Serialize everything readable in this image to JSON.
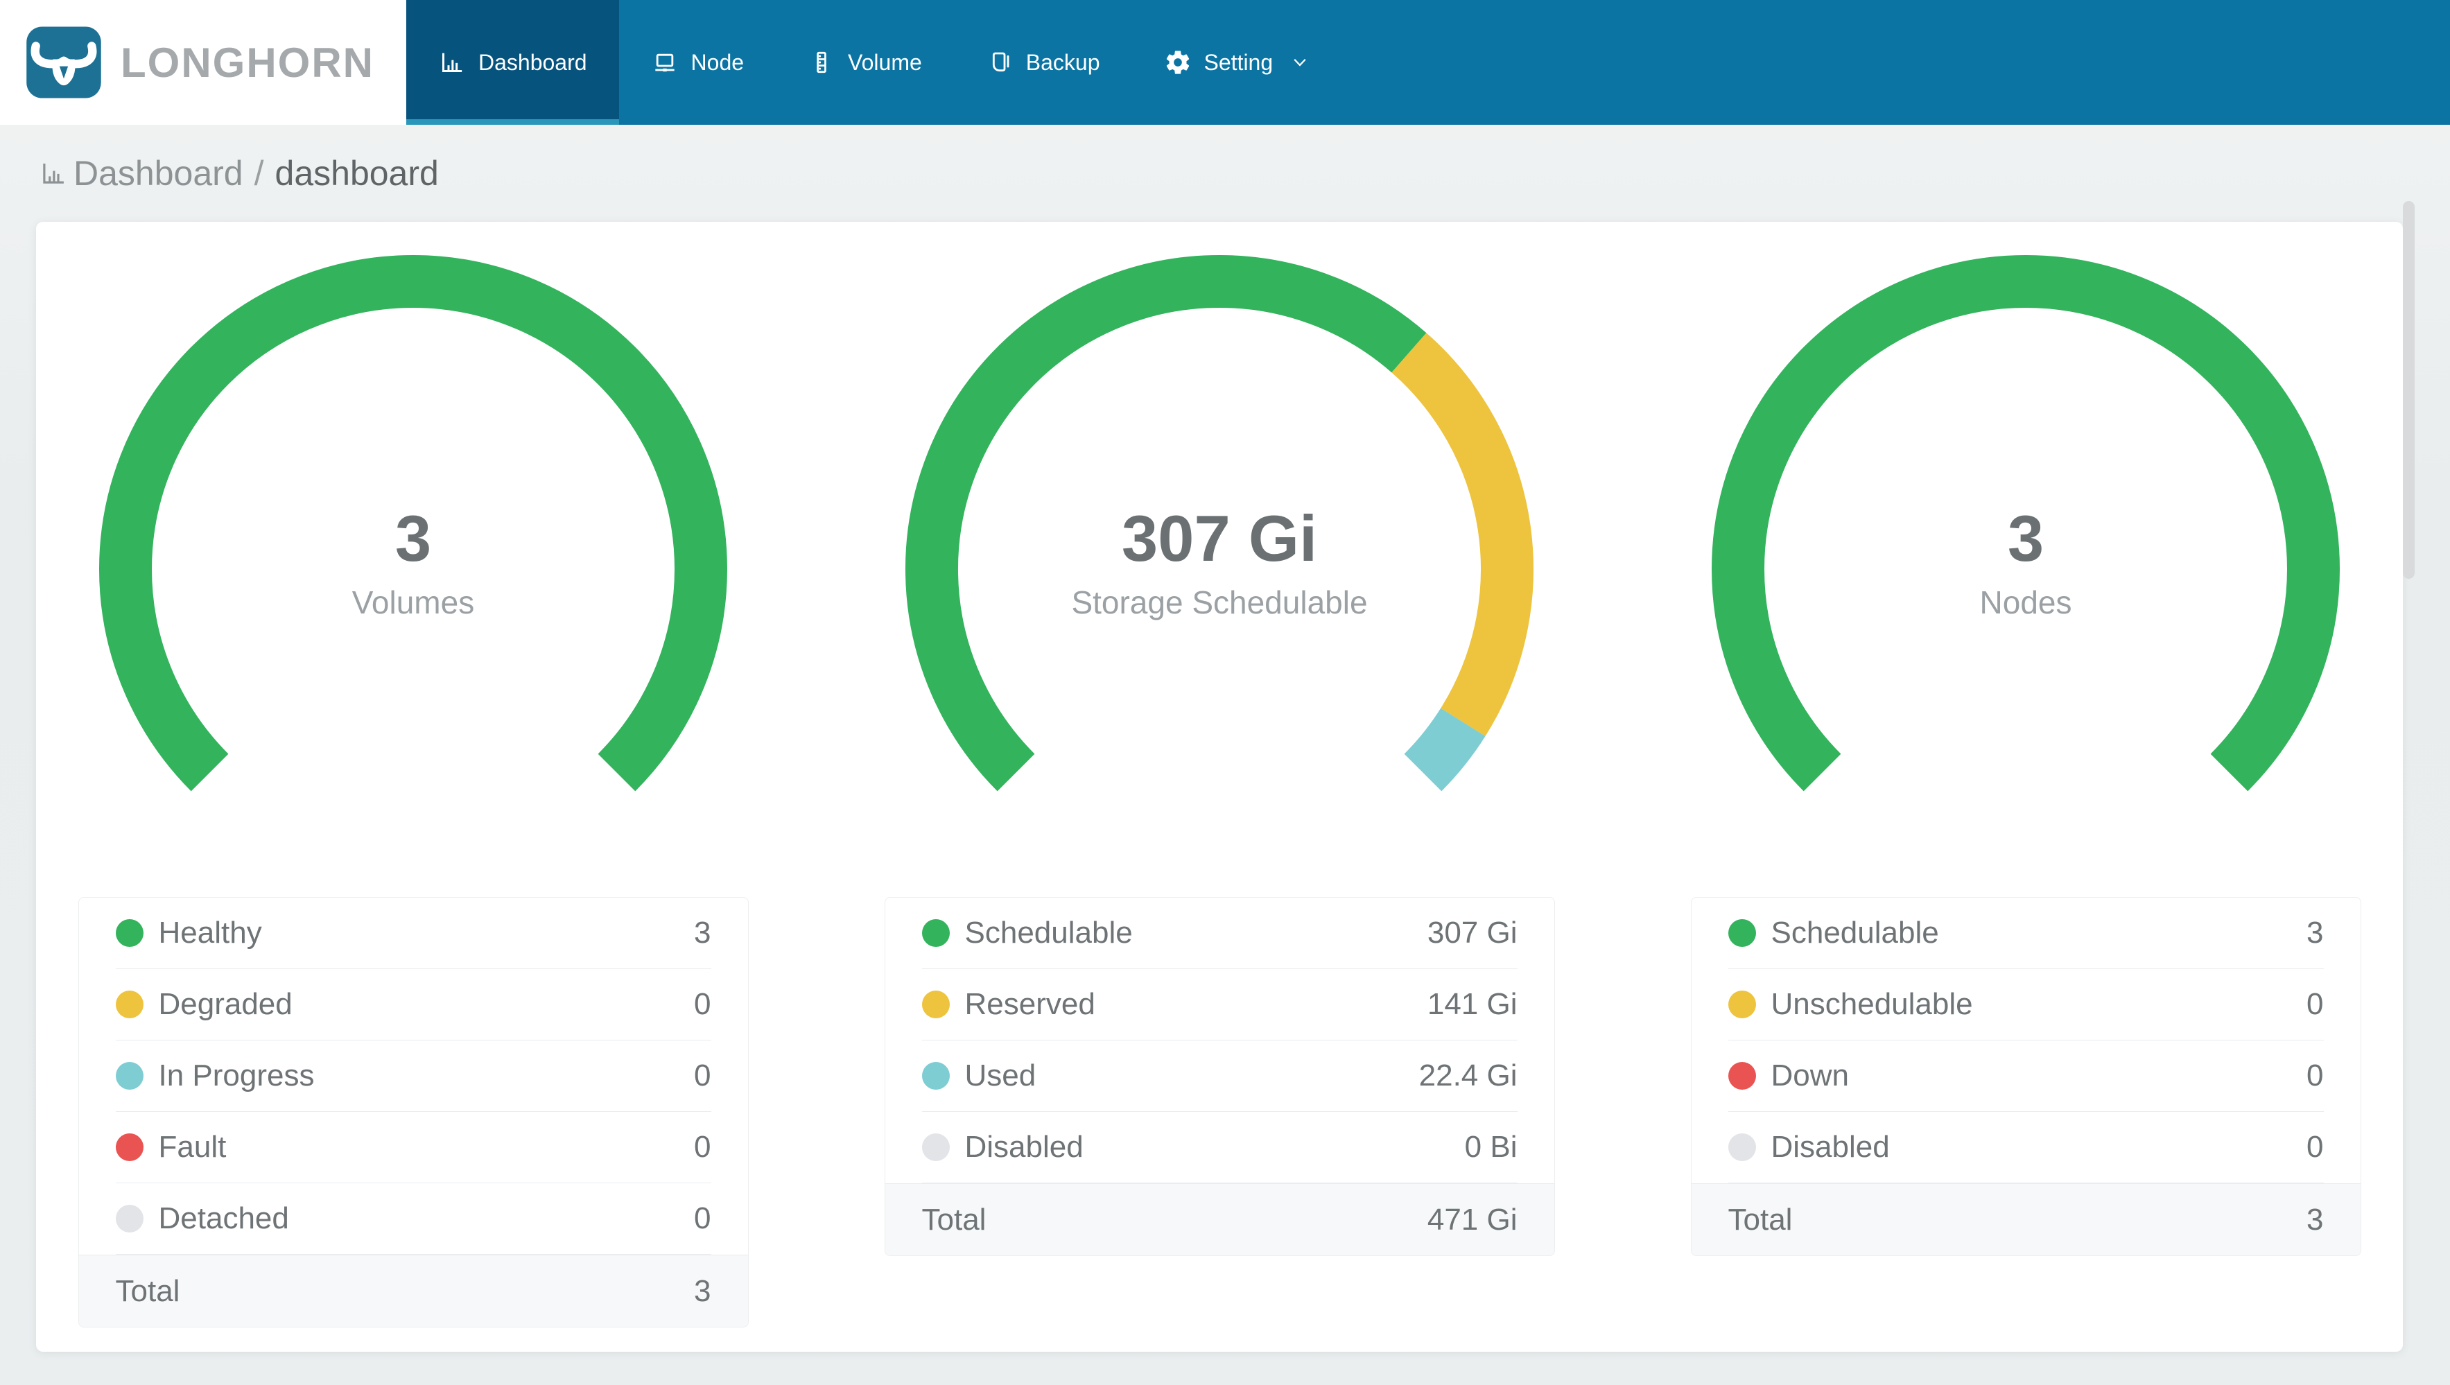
{
  "brand": {
    "name": "LONGHORN"
  },
  "nav": {
    "items": [
      {
        "label": "Dashboard",
        "icon": "bar-chart-icon",
        "active": true
      },
      {
        "label": "Node",
        "icon": "laptop-icon",
        "active": false
      },
      {
        "label": "Volume",
        "icon": "database-icon",
        "active": false
      },
      {
        "label": "Backup",
        "icon": "backup-icon",
        "active": false
      },
      {
        "label": "Setting",
        "icon": "gear-icon",
        "active": false,
        "has_dropdown": true
      }
    ]
  },
  "breadcrumb": {
    "icon": "bar-chart-icon",
    "section": "Dashboard",
    "separator": "/",
    "page": "dashboard"
  },
  "colors": {
    "nav_bg": "#0b74a3",
    "nav_active_bg": "#06537e",
    "nav_active_underline": "#2a97ba",
    "brand_blue": "#1d7195",
    "green": "#32b35c",
    "yellow": "#eec33d",
    "teal": "#7ecdd3",
    "red": "#e95352",
    "gray": "#e2e4e7",
    "text_dark": "#6b7073",
    "text_light": "#9aa0a3"
  },
  "chart_data": [
    {
      "type": "gauge-donut",
      "title": "Volumes",
      "center_value": "3",
      "center_label": "Volumes",
      "arc_degrees": 270,
      "segments": [
        {
          "name": "Healthy",
          "value": 3,
          "color": "#32b35c"
        },
        {
          "name": "Degraded",
          "value": 0,
          "color": "#eec33d"
        },
        {
          "name": "In Progress",
          "value": 0,
          "color": "#7ecdd3"
        },
        {
          "name": "Fault",
          "value": 0,
          "color": "#e95352"
        },
        {
          "name": "Detached",
          "value": 0,
          "color": "#e2e4e7"
        }
      ],
      "legend": [
        {
          "label": "Healthy",
          "value": "3",
          "color": "#32b35c"
        },
        {
          "label": "Degraded",
          "value": "0",
          "color": "#eec33d"
        },
        {
          "label": "In Progress",
          "value": "0",
          "color": "#7ecdd3"
        },
        {
          "label": "Fault",
          "value": "0",
          "color": "#e95352"
        },
        {
          "label": "Detached",
          "value": "0",
          "color": "#e2e4e7"
        }
      ],
      "total_label": "Total",
      "total_value": "3"
    },
    {
      "type": "gauge-donut",
      "title": "Storage Schedulable",
      "center_value": "307 Gi",
      "center_label": "Storage Schedulable",
      "arc_degrees": 270,
      "segments": [
        {
          "name": "Schedulable",
          "value": 307,
          "color": "#32b35c"
        },
        {
          "name": "Reserved",
          "value": 141,
          "color": "#eec33d"
        },
        {
          "name": "Used",
          "value": 22.4,
          "color": "#7ecdd3"
        },
        {
          "name": "Disabled",
          "value": 0,
          "color": "#e2e4e7"
        }
      ],
      "legend": [
        {
          "label": "Schedulable",
          "value": "307 Gi",
          "color": "#32b35c"
        },
        {
          "label": "Reserved",
          "value": "141 Gi",
          "color": "#eec33d"
        },
        {
          "label": "Used",
          "value": "22.4 Gi",
          "color": "#7ecdd3"
        },
        {
          "label": "Disabled",
          "value": "0 Bi",
          "color": "#e2e4e7"
        }
      ],
      "total_label": "Total",
      "total_value": "471 Gi"
    },
    {
      "type": "gauge-donut",
      "title": "Nodes",
      "center_value": "3",
      "center_label": "Nodes",
      "arc_degrees": 270,
      "segments": [
        {
          "name": "Schedulable",
          "value": 3,
          "color": "#32b35c"
        },
        {
          "name": "Unschedulable",
          "value": 0,
          "color": "#eec33d"
        },
        {
          "name": "Down",
          "value": 0,
          "color": "#e95352"
        },
        {
          "name": "Disabled",
          "value": 0,
          "color": "#e2e4e7"
        }
      ],
      "legend": [
        {
          "label": "Schedulable",
          "value": "3",
          "color": "#32b35c"
        },
        {
          "label": "Unschedulable",
          "value": "0",
          "color": "#eec33d"
        },
        {
          "label": "Down",
          "value": "0",
          "color": "#e95352"
        },
        {
          "label": "Disabled",
          "value": "0",
          "color": "#e2e4e7"
        }
      ],
      "total_label": "Total",
      "total_value": "3"
    }
  ]
}
